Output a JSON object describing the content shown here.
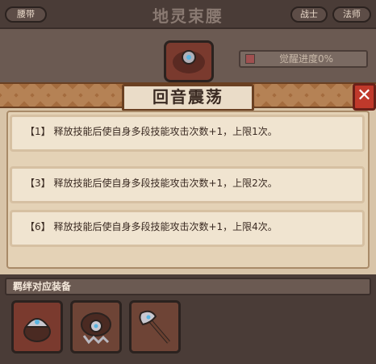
{
  "background": {
    "tab_left": "腰带",
    "title": "地灵束腰",
    "tab_warrior": "战士",
    "tab_mage": "法师",
    "awaken_progress": "觉醒进度0%"
  },
  "popup": {
    "title": "回音震荡",
    "close_symbol": "✕",
    "effects": [
      "【1】 释放技能后使自身多段技能攻击次数+1，上限1次。",
      "【3】 释放技能后使自身多段技能攻击次数+1，上限2次。",
      "【6】 释放技能后使自身多段技能攻击次数+1，上限4次。"
    ]
  },
  "bond": {
    "header": "羁绊对应装备",
    "items": [
      {
        "icon": "helmet-icon"
      },
      {
        "icon": "belt-icon"
      },
      {
        "icon": "axe-icon"
      }
    ]
  },
  "colors": {
    "close_button": "#c0392b",
    "slot_bg": "#7a3a2e",
    "band": "#a46c3e"
  }
}
